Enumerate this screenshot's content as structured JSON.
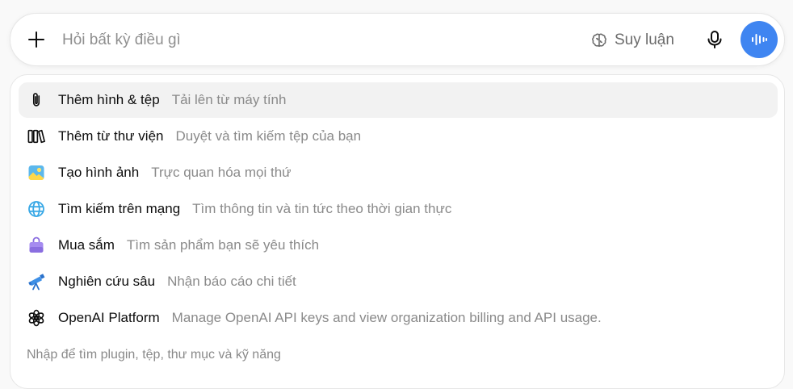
{
  "composer": {
    "placeholder": "Hỏi bất kỳ điều gì",
    "reasoning_label": "Suy luận",
    "accent_color": "#3f85f1"
  },
  "menu": {
    "items": [
      {
        "icon": "paperclip-icon",
        "title": "Thêm hình & tệp",
        "description": "Tải lên từ máy tính"
      },
      {
        "icon": "library-icon",
        "title": "Thêm từ thư viện",
        "description": "Duyệt và tìm kiếm tệp của bạn"
      },
      {
        "icon": "image-icon",
        "title": "Tạo hình ảnh",
        "description": "Trực quan hóa mọi thứ"
      },
      {
        "icon": "globe-icon",
        "title": "Tìm kiếm trên mạng",
        "description": "Tìm thông tin và tin tức theo thời gian thực"
      },
      {
        "icon": "shopping-bag-icon",
        "title": "Mua sắm",
        "description": "Tìm sản phẩm bạn sẽ yêu thích"
      },
      {
        "icon": "telescope-icon",
        "title": "Nghiên cứu sâu",
        "description": "Nhận báo cáo chi tiết"
      },
      {
        "icon": "openai-logo-icon",
        "title": "OpenAI Platform",
        "description": "Manage OpenAI API keys and view organization billing and API usage."
      }
    ],
    "hint": "Nhập để tìm plugin, tệp, thư mục và kỹ năng"
  }
}
